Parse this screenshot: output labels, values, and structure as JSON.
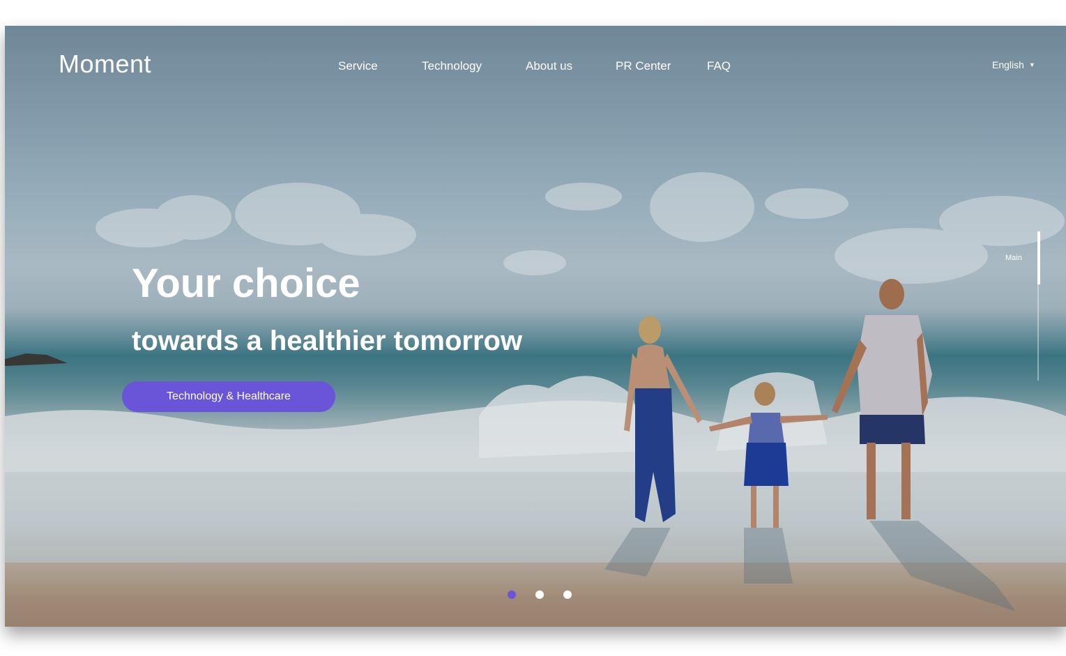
{
  "brand": {
    "logo": "Moment"
  },
  "nav": {
    "items": [
      {
        "label": "Service"
      },
      {
        "label": "Technology"
      },
      {
        "label": "About us"
      },
      {
        "label": "PR Center"
      },
      {
        "label": "FAQ"
      }
    ]
  },
  "language": {
    "selected": "English",
    "icon": "caret-down-icon"
  },
  "hero": {
    "title": "Your choice",
    "subtitle": "towards a healthier tomorrow",
    "cta_label": "Technology & Healthcare"
  },
  "side_indicator": {
    "label": "Main"
  },
  "slider": {
    "count": 3,
    "active_index": 0
  },
  "colors": {
    "accent": "#6a55d9",
    "text": "#ffffff"
  }
}
